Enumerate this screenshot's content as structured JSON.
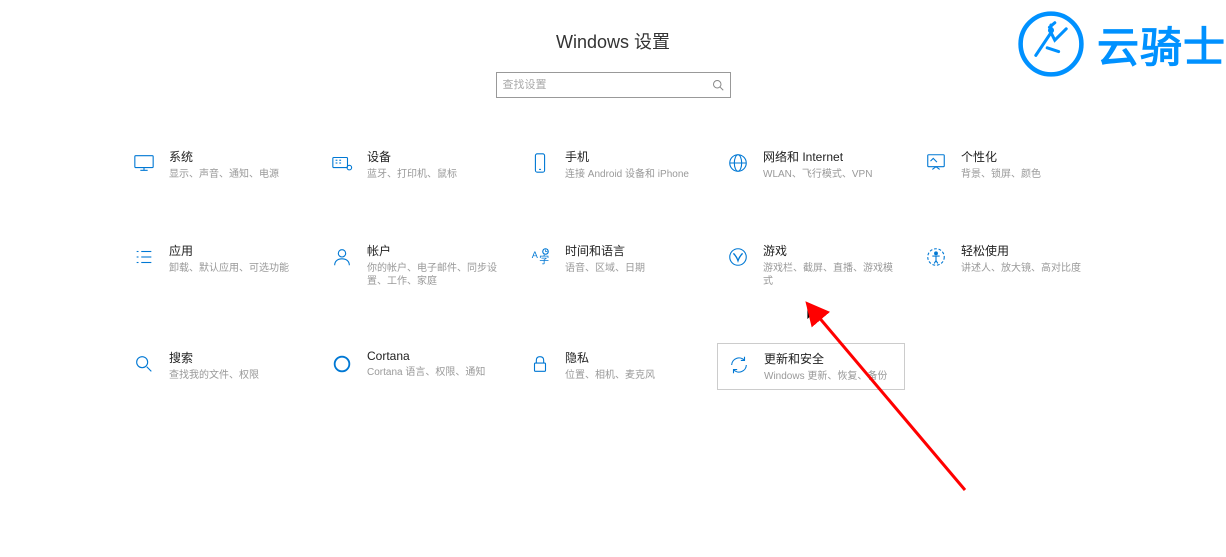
{
  "page_title": "Windows 设置",
  "search": {
    "placeholder": "查找设置"
  },
  "watermark": {
    "text": "云骑士"
  },
  "items": [
    {
      "title": "系统",
      "desc": "显示、声音、通知、电源"
    },
    {
      "title": "设备",
      "desc": "蓝牙、打印机、鼠标"
    },
    {
      "title": "手机",
      "desc": "连接 Android 设备和 iPhone"
    },
    {
      "title": "网络和 Internet",
      "desc": "WLAN、飞行模式、VPN"
    },
    {
      "title": "个性化",
      "desc": "背景、锁屏、颜色"
    },
    {
      "title": "应用",
      "desc": "卸载、默认应用、可选功能"
    },
    {
      "title": "帐户",
      "desc": "你的帐户、电子邮件、同步设置、工作、家庭"
    },
    {
      "title": "时间和语言",
      "desc": "语音、区域、日期"
    },
    {
      "title": "游戏",
      "desc": "游戏栏、截屏、直播、游戏模式"
    },
    {
      "title": "轻松使用",
      "desc": "讲述人、放大镜、高对比度"
    },
    {
      "title": "搜索",
      "desc": "查找我的文件、权限"
    },
    {
      "title": "Cortana",
      "desc": "Cortana 语言、权限、通知"
    },
    {
      "title": "隐私",
      "desc": "位置、相机、麦克风"
    },
    {
      "title": "更新和安全",
      "desc": "Windows 更新、恢复、备份"
    }
  ]
}
